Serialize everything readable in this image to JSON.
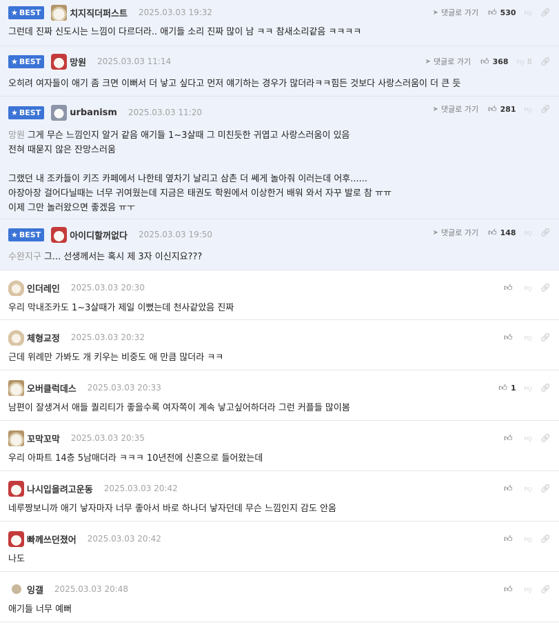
{
  "labels": {
    "best": "BEST",
    "reply": "댓글로 가기"
  },
  "comments": [
    {
      "nick": "치지직더퍼스트",
      "date": "2025.03.03 19:32",
      "up": "530",
      "down": "",
      "ref": "",
      "lines": [
        "그런데 진짜 신도시는 느낌이 다르더라.. 애기들 소리 진짜 많이 남 ㅋㅋ 참새소리같음 ㅋㅋㅋㅋ"
      ]
    },
    {
      "nick": "망원",
      "date": "2025.03.03 11:14",
      "up": "368",
      "down": "8",
      "ref": "",
      "lines": [
        "오히려 여자들이 애기 좀 크면 이뻐서 더 낳고 싶다고 먼저 얘기하는 경우가 많더라ㅋㅋ힘든 것보다 사랑스러움이 더 큰 듯"
      ]
    },
    {
      "nick": "urbanism",
      "date": "2025.03.03 11:20",
      "up": "281",
      "down": "",
      "ref": "망원",
      "lines": [
        "그게 무슨 느낌인지 알거 같음 애기들 1~3살때 그 미친듯한 귀엽고 사랑스러움이 있음",
        "전혀 때묻지 않은 잔망스러움",
        "",
        "그랬던 내 조카들이 키즈 카페에서 나한테 옆차기 날리고 삼촌 더 쎄게 놀아줘 이러는데 어후......",
        "아장아장 걸어다닐때는 너무 귀여웠는데 지금은 태권도 학원에서 이상한거 배워 와서 자꾸 발로 참 ㅠㅠ",
        "이제 그만 놀러왔으면 좋겠음 ㅠㅜ"
      ]
    },
    {
      "nick": "아이디할꺼없다",
      "date": "2025.03.03 19:50",
      "up": "148",
      "down": "",
      "ref": "수완지구",
      "lines": [
        "그... 선생께서는 혹시 제 3자 이신지요???"
      ]
    },
    {
      "nick": "인더레인",
      "date": "2025.03.03 20:30",
      "up": "",
      "down": "",
      "ref": "",
      "lines": [
        "우리 막내조카도 1~3살때가 제일 이뻤는데 천사같았음 진짜"
      ]
    },
    {
      "nick": "체형교정",
      "date": "2025.03.03 20:32",
      "up": "",
      "down": "",
      "ref": "",
      "lines": [
        "근데 위례만 가봐도 개 키우는 비중도 애 만큼 많더라 ㅋㅋ"
      ]
    },
    {
      "nick": "오버클럭데스",
      "date": "2025.03.03 20:33",
      "up": "1",
      "down": "",
      "ref": "",
      "lines": [
        "남편이 잘생겨서 애들 퀄리티가 좋을수록 여자쪽이 계속 낳고싶어하더라 그런 커플들 많이봄"
      ]
    },
    {
      "nick": "꼬막꼬막",
      "date": "2025.03.03 20:35",
      "up": "",
      "down": "",
      "ref": "",
      "lines": [
        "우리 아파트 14층 5남매더라 ㅋㅋㅋ 10년전에 신혼으로 들어왔는데"
      ]
    },
    {
      "nick": "나시입을려고운동",
      "date": "2025.03.03 20:42",
      "up": "",
      "down": "",
      "ref": "",
      "lines": [
        "네루짱보니까 애기 낳자마자 너무 좋아서 바로 하나더 낳자던데 무슨 느낌인지 감도 안옴"
      ]
    },
    {
      "nick": "빠께쓰던졌어",
      "date": "2025.03.03 20:42",
      "up": "",
      "down": "",
      "ref": "",
      "lines": [
        "나도"
      ]
    },
    {
      "nick": "잉갤",
      "date": "2025.03.03 20:48",
      "up": "",
      "down": "",
      "ref": "",
      "lines": [
        "애기들 너무 예뻐"
      ]
    }
  ]
}
